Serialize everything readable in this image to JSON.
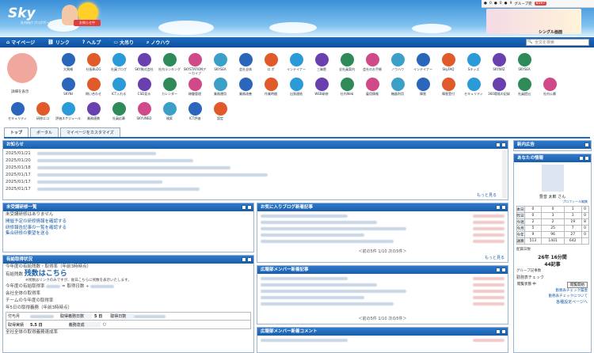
{
  "header": {
    "logo": "Sky",
    "logo_sub": "社内向けブログポータル",
    "badge": "お知らせ中",
    "single": "シングル画面",
    "util": {
      "a": "0",
      "b": "0",
      "c": "9",
      "group": "グループ宛",
      "badge": "8597"
    }
  },
  "nav": {
    "items": [
      "マイページ",
      "リンク",
      "ヘルプ",
      "大吊り",
      "ノウハウ"
    ],
    "search_placeholder": "全文を検索"
  },
  "apps": {
    "profile_label": "詳細を表示",
    "row1": [
      "大黒様",
      "社長BLOG",
      "社員ブログ",
      "SKY株式会社",
      "社内ランキング",
      "SKYSTATIONアーカイブ",
      "SKYSEA",
      "会社全体",
      "ロ ボ",
      "インテイナー",
      "三昧肥",
      "全社員案内",
      "会社のお手帳",
      "ノウハウ",
      "インテイナー",
      "SkyFAQ",
      "Sキッズ",
      "SKYWIZ",
      "SKYSEA"
    ],
    "row2": [
      "SKYNI",
      "問い合わせ",
      "ICT入れる",
      "CSD見る",
      "カレンダー",
      "稼働管理",
      "業務運用",
      "業務改善",
      "作業時間",
      "出張連結",
      "WEB研修",
      "社内Web",
      "雇用情報",
      "機器利用",
      "障害",
      "障害受付",
      "セキュリティ",
      "360環境の記録",
      "社員提出",
      "社内公募"
    ],
    "row3": [
      "セキュリティ",
      "研修エコ",
      "評価スケジュール",
      "業務連携",
      "社員応募",
      "SKYUNED",
      "検索",
      "ICT評価",
      "設定"
    ]
  },
  "tabs": [
    "トップ",
    "ポータル",
    "マイページをカスタマイズ"
  ],
  "news": {
    "title": "お知らせ",
    "dates": [
      "2025/01/21",
      "2025/01/20",
      "2025/01/18",
      "2025/01/17",
      "2025/01/17",
      "2025/01/17"
    ],
    "more": "もっと見る"
  },
  "training": {
    "title": "未受講研修一覧",
    "empty": "未受講研修はありません",
    "links": [
      "開催予定の研修情報を確認する",
      "研修報告記事の一覧を確認する",
      "集合研修の要望を送る"
    ]
  },
  "blogfav": {
    "title": "お気に入りブログ新着記事",
    "pager": "＜前の5件 1/10 次の5件＞",
    "more": "もっと見る"
  },
  "leave": {
    "title": "有給取得状況",
    "lines": [
      "今年度の有給残数・取得率（年前3時時点）"
    ],
    "remaining_label": "有給残数",
    "remaining_link": "残数はこちら",
    "note": "※残数はリンクのみですが、後日こちらに残数を表示いたします。",
    "rate_label": "今年度の有給取得率",
    "rate_formula": "= 取得日数 ÷",
    "company_rate": "会社全体の取得率",
    "team_rate": "チームの今年度の取得率",
    "five_day": "年5日の取得義務（年前3時時点）",
    "given": "付与月",
    "days_label": "取得義務日数",
    "days": "5 日",
    "taken_label": "取得日数",
    "taken": "5.5 日",
    "remain_label": "義務達成",
    "company_five": "全社全体の取得義務達成率"
  },
  "pr_member": {
    "title": "広報部メンバー新着記事",
    "pager": "＜前の5件 1/10 次の5件＞"
  },
  "pr_comment": {
    "title": "広報部メンバー新着コメント"
  },
  "right": {
    "title1": "新内広告",
    "title2": "あなたの情報",
    "user": "豊音 太郎 さん",
    "profile_edit": "プロフィール編集",
    "calendar": {
      "rows": [
        [
          "本日",
          "0",
          "0",
          "1",
          "0"
        ],
        [
          "昨日",
          "0",
          "3",
          "3",
          "0"
        ],
        [
          "今週",
          "2",
          "2",
          "19",
          "8"
        ],
        [
          "今月",
          "5",
          "25",
          "7",
          "0"
        ],
        [
          "今年",
          "9",
          "96",
          "27",
          "0"
        ],
        [
          "通算",
          "513",
          "1401",
          "642",
          ""
        ]
      ]
    },
    "assign_date": "配属日数",
    "days_val": "26年",
    "total": "16分間",
    "count": "44記事",
    "label_group": "グループ記事数",
    "commute": "勤務表チェック",
    "commute_btn": "閲覧開始",
    "links": [
      "勤務表チェック履歴",
      "勤務表チェックについて",
      "各種設定ページへ"
    ],
    "status": "閲覧状態 中"
  }
}
